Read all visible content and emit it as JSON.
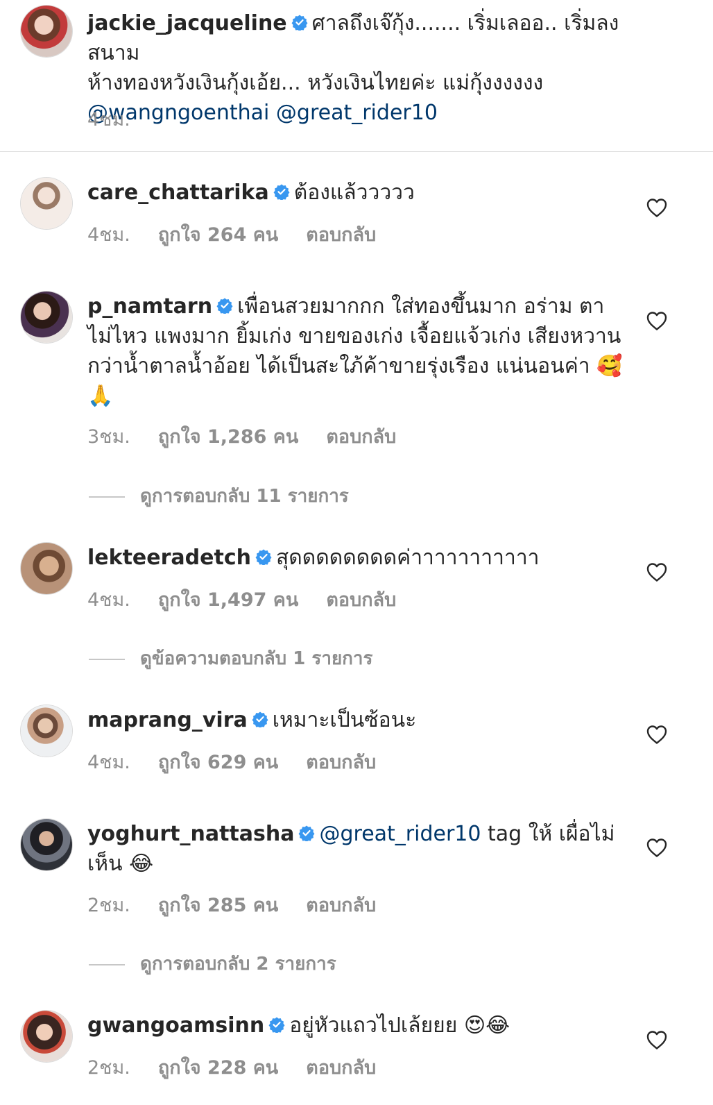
{
  "caption": {
    "username": "jackie_jacqueline",
    "text_line1": "ศาลถึงเจ๊กุ้ง....... เริ่มเลออ.. เริ่มลงสนาม",
    "text_line2": "ห้างทองหวังเงินกุ้งเอ้ย... หวังเงินไทยค่ะ แม่กุ้งงงงงง",
    "mention1": "@wangngoenthai",
    "mention2": "@great_rider10",
    "time": "4ชม."
  },
  "comments": [
    {
      "username": "care_chattarika",
      "text": "ต้องแล้ววววว",
      "time": "4ชม.",
      "likes": "ถูกใจ 264 คน",
      "reply": "ตอบกลับ"
    },
    {
      "username": "p_namtarn",
      "text": "เพื่อนสวยมากกก ใส่ทองขึ้นมาก อร่าม ตาไม่ไหว แพงมาก ยิ้มเก่ง ขายของเก่ง เจื้อยแจ้วเก่ง เสียงหวานกว่าน้ำตาลน้ำอ้อย ได้เป็นสะใภ้ค้าขายรุ่งเรือง แน่นอนค่า",
      "emoji": "🥰🙏",
      "time": "3ชม.",
      "likes": "ถูกใจ 1,286 คน",
      "reply": "ตอบกลับ",
      "view_replies": "ดูการตอบกลับ 11 รายการ"
    },
    {
      "username": "lekteeradetch",
      "text": "สุดดดดดดดดค่าาาาาาาาาาา",
      "time": "4ชม.",
      "likes": "ถูกใจ 1,497 คน",
      "reply": "ตอบกลับ",
      "view_replies": "ดูข้อความตอบกลับ 1 รายการ"
    },
    {
      "username": "maprang_vira",
      "text": "เหมาะเป็นซ้อนะ",
      "time": "4ชม.",
      "likes": "ถูกใจ 629 คน",
      "reply": "ตอบกลับ"
    },
    {
      "username": "yoghurt_nattasha",
      "mention": "@great_rider10",
      "text": " tag ให้ เผื่อไม่เห็น",
      "emoji": "😂",
      "time": "2ชม.",
      "likes": "ถูกใจ 285 คน",
      "reply": "ตอบกลับ",
      "view_replies": "ดูการตอบกลับ 2 รายการ"
    },
    {
      "username": "gwangoamsinn",
      "text": "อยู่หัวแถวไปเล้ยยย",
      "emoji": "😍😂",
      "time": "2ชม.",
      "likes": "ถูกใจ 228 คน",
      "reply": "ตอบกลับ"
    }
  ],
  "colors": {
    "verified": "#3897f0",
    "mention": "#00376b",
    "secondary": "#8e8e8e",
    "primary": "#262626"
  },
  "icons": {
    "verified": "verified-badge-icon",
    "like": "heart-outline-icon"
  }
}
